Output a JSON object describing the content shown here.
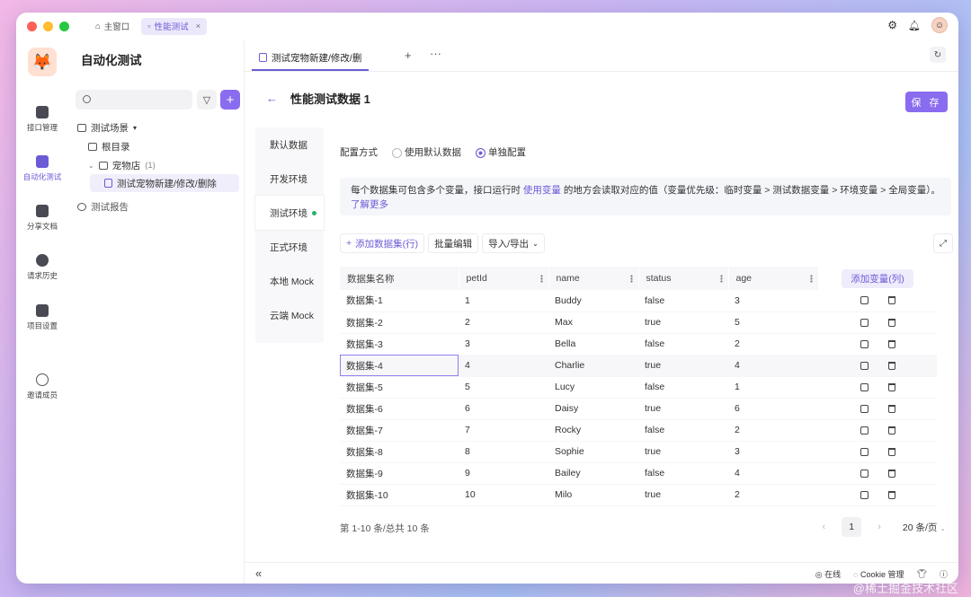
{
  "topbar": {
    "tab_home": "主窗口",
    "tab_perf": "性能测试",
    "tab_close": "×"
  },
  "rail": {
    "items": [
      "接口管理",
      "自动化测试",
      "分享文档",
      "请求历史",
      "项目设置",
      "邀请成员"
    ],
    "active_index": 1
  },
  "tree": {
    "title": "自动化测试",
    "scene_label": "测试场景",
    "root_dir": "根目录",
    "folder": "宠物店",
    "folder_count": "(1)",
    "case": "测试宠物新建/修改/删除",
    "report": "测试报告"
  },
  "doc_tab": {
    "label": "测试宠物新建/修改/删",
    "plus": "+",
    "more": "···"
  },
  "page": {
    "title": "性能测试数据 1",
    "back": "←",
    "save": "保 存"
  },
  "envs": [
    {
      "label": "默认数据",
      "active": false
    },
    {
      "label": "开发环境",
      "active": false
    },
    {
      "label": "测试环境",
      "active": true
    },
    {
      "label": "正式环境",
      "active": false
    },
    {
      "label": "本地 Mock",
      "active": false
    },
    {
      "label": "云端 Mock",
      "active": false
    }
  ],
  "config": {
    "label": "配置方式",
    "option_default": "使用默认数据",
    "option_custom": "单独配置",
    "selected": "单独配置"
  },
  "info": {
    "text1": "每个数据集可包含多个变量，接口运行时 ",
    "link1": "使用变量",
    "text2": " 的地方会读取对应的值（变量优先级：临时变量 > 测试数据变量 > 环境变量 > 全局变量）。",
    "link2": "了解更多"
  },
  "toolbar": {
    "add_row": "添加数据集(行)",
    "batch_edit": "批量编辑",
    "import_export": "导入/导出"
  },
  "table": {
    "columns": [
      "数据集名称",
      "petId",
      "name",
      "status",
      "age"
    ],
    "add_col": "添加变量(列)",
    "rows": [
      [
        "数据集-1",
        "1",
        "Buddy",
        "false",
        "3"
      ],
      [
        "数据集-2",
        "2",
        "Max",
        "true",
        "5"
      ],
      [
        "数据集-3",
        "3",
        "Bella",
        "false",
        "2"
      ],
      [
        "数据集-4",
        "4",
        "Charlie",
        "true",
        "4"
      ],
      [
        "数据集-5",
        "5",
        "Lucy",
        "false",
        "1"
      ],
      [
        "数据集-6",
        "6",
        "Daisy",
        "true",
        "6"
      ],
      [
        "数据集-7",
        "7",
        "Rocky",
        "false",
        "2"
      ],
      [
        "数据集-8",
        "8",
        "Sophie",
        "true",
        "3"
      ],
      [
        "数据集-9",
        "9",
        "Bailey",
        "false",
        "4"
      ],
      [
        "数据集-10",
        "10",
        "Milo",
        "true",
        "2"
      ]
    ],
    "highlight_row": 3
  },
  "pagination": {
    "summary": "第 1-10 条/总共 10 条",
    "current": "1",
    "page_size": "20 条/页",
    "prev": "‹",
    "next": "›"
  },
  "footer": {
    "status": "在线",
    "cookie": "Cookie 管理",
    "collapse": "«"
  },
  "watermark": "@稀土掘金技术社区",
  "colors": {
    "accent": "#8a6cf0",
    "accent_text": "#6b5bd6",
    "online": "#24b36b"
  }
}
